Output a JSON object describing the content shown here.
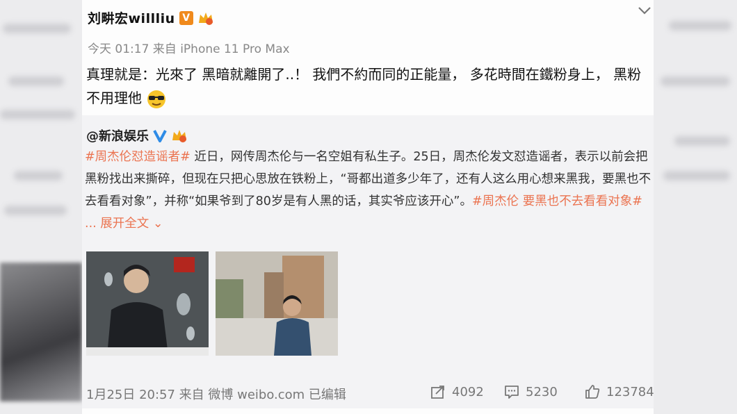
{
  "post": {
    "username": "刘畊宏willliu",
    "v_badge": "V",
    "meta": "今天 01:17 来自 iPhone 11 Pro Max",
    "text": "真理就是：光來了 黑暗就離開了..！ 我們不約而同的正能量， 多花時間在鐵粉身上， 黑粉不用理他"
  },
  "repost": {
    "username": "@新浪娱乐",
    "tag1": "#周杰伦怼造谣者#",
    "body": " 近日，网传周杰伦与一名空姐有私生子。25日，周杰伦发文怼造谣者，表示以前会把黑粉找出来撕碎，但现在只把心思放在铁粉上，“哥都出道多少年了，还有人这么用心想来黑我，要黑也不去看看对象”，并称“如果爷到了80岁是有人黑的话，其实爷应该开心”。",
    "tag2": "#周杰伦 要黑也不去看看对象#",
    "expand": " ... 展开全文 ⌄",
    "footer_meta": "1月25日 20:57 来自 微博 weibo.com  已编辑",
    "reposts": "4092",
    "comments": "5230",
    "likes": "123784"
  },
  "icons": [
    "chevron-down-icon",
    "verified-v-icon",
    "crown-icon",
    "sunglasses-emoji-icon",
    "share-icon",
    "comment-icon",
    "like-icon"
  ],
  "colors": {
    "tag": "#eb7350",
    "verified_orange": "#f08a1c",
    "verified_blue": "#2e8be6"
  }
}
